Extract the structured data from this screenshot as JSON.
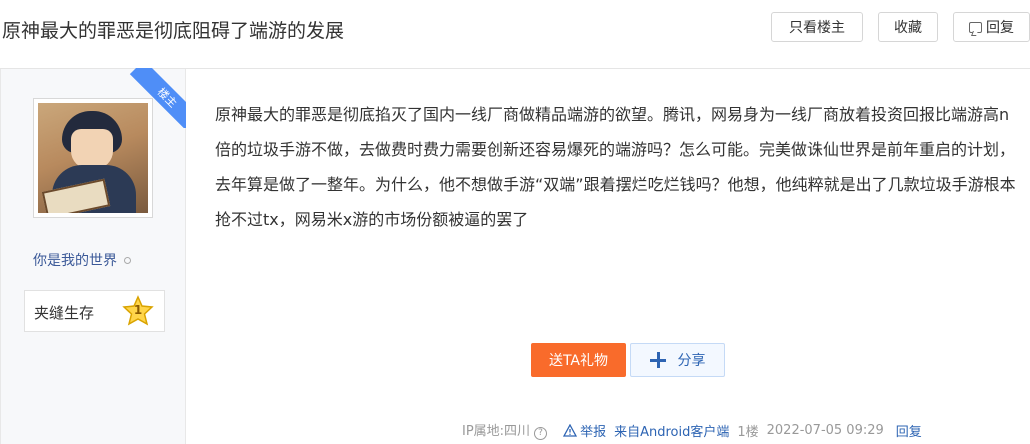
{
  "thread": {
    "title": "原神最大的罪恶是彻底阻碍了端游的发展"
  },
  "header_buttons": {
    "only_op": "只看楼主",
    "favorite": "收藏",
    "reply": "回复"
  },
  "post": {
    "ribbon_label": "楼主",
    "author": {
      "name": "你是我的世界",
      "level_name": "夹缝生存",
      "level": "1"
    },
    "content": "原神最大的罪恶是彻底掐灭了国内一线厂商做精品端游的欲望。腾讯，网易身为一线厂商放着投资回报比端游高n倍的垃圾手游不做，去做费时费力需要创新还容易爆死的端游吗？怎么可能。完美做诛仙世界是前年重启的计划，去年算是做了一整年。为什么，他不想做手游“双端”跟着摆烂吃烂钱吗？他想，他纯粹就是出了几款垃圾手游根本抢不过tx，网易米x游的市场份额被逼的罢了",
    "actions": {
      "gift": "送TA礼物",
      "share": "分享"
    },
    "meta": {
      "ip": "IP属地:四川",
      "report": "举报",
      "client": "来自Android客户端",
      "floor": "1楼",
      "time": "2022-07-05 09:29",
      "reply": "回复"
    }
  },
  "colors": {
    "accent_blue": "#2d64b3",
    "ribbon_blue": "#4f8ef7",
    "gift_orange": "#f96b2b"
  }
}
